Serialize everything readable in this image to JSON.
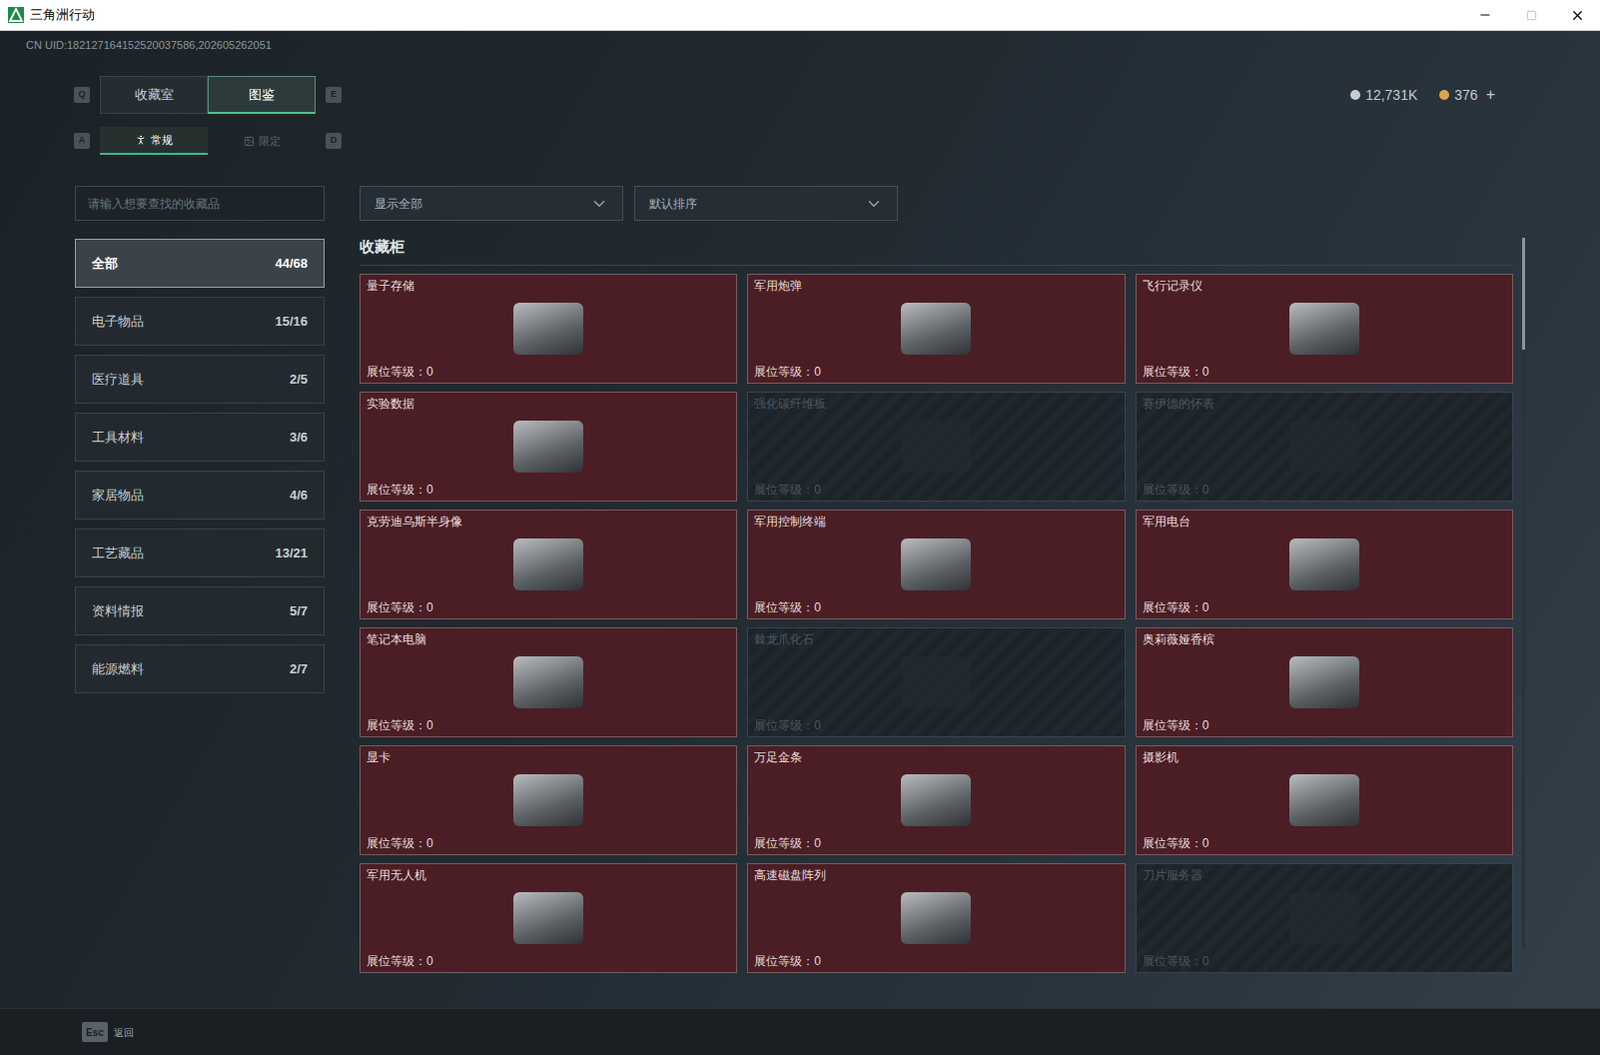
{
  "window": {
    "title": "三角洲行动"
  },
  "uid": "CN UID:182127164152520037586,202605262051",
  "main_tabs": {
    "prev_key": "Q",
    "next_key": "E",
    "items": [
      {
        "label": "收藏室",
        "selected": false
      },
      {
        "label": "图鉴",
        "selected": true
      }
    ]
  },
  "sub_tabs": {
    "prev_key": "A",
    "next_key": "D",
    "items": [
      {
        "label": "常规",
        "selected": true
      },
      {
        "label": "限定",
        "selected": false
      }
    ]
  },
  "currency": [
    {
      "value": "12,731K",
      "color": "#c9ccce"
    },
    {
      "value": "376",
      "color": "#d9a64a"
    }
  ],
  "currency_add": "+",
  "search": {
    "placeholder": "请输入想要查找的收藏品"
  },
  "filters": [
    {
      "label": "显示全部"
    },
    {
      "label": "默认排序"
    }
  ],
  "sidebar": {
    "items": [
      {
        "label": "全部",
        "count": "44/68",
        "selected": true
      },
      {
        "label": "电子物品",
        "count": "15/16",
        "selected": false
      },
      {
        "label": "医疗道具",
        "count": "2/5",
        "selected": false
      },
      {
        "label": "工具材料",
        "count": "3/6",
        "selected": false
      },
      {
        "label": "家居物品",
        "count": "4/6",
        "selected": false
      },
      {
        "label": "工艺藏品",
        "count": "13/21",
        "selected": false
      },
      {
        "label": "资料情报",
        "count": "5/7",
        "selected": false
      },
      {
        "label": "能源燃料",
        "count": "2/7",
        "selected": false
      }
    ]
  },
  "section_title": "收藏柜",
  "cards": [
    {
      "name": "量子存储",
      "level_label": "展位等级：",
      "level": "0",
      "unlocked": true
    },
    {
      "name": "军用炮弹",
      "level_label": "展位等级：",
      "level": "0",
      "unlocked": true
    },
    {
      "name": "飞行记录仪",
      "level_label": "展位等级：",
      "level": "0",
      "unlocked": true
    },
    {
      "name": "实验数据",
      "level_label": "展位等级：",
      "level": "0",
      "unlocked": true
    },
    {
      "name": "强化碳纤维板",
      "level_label": "展位等级：",
      "level": "0",
      "unlocked": false
    },
    {
      "name": "赛伊德的怀表",
      "level_label": "展位等级：",
      "level": "0",
      "unlocked": false
    },
    {
      "name": "克劳迪乌斯半身像",
      "level_label": "展位等级：",
      "level": "0",
      "unlocked": true
    },
    {
      "name": "军用控制终端",
      "level_label": "展位等级：",
      "level": "0",
      "unlocked": true
    },
    {
      "name": "军用电台",
      "level_label": "展位等级：",
      "level": "0",
      "unlocked": true
    },
    {
      "name": "笔记本电脑",
      "level_label": "展位等级：",
      "level": "0",
      "unlocked": true
    },
    {
      "name": "棘龙爪化石",
      "level_label": "展位等级：",
      "level": "0",
      "unlocked": false
    },
    {
      "name": "奥莉薇娅香槟",
      "level_label": "展位等级：",
      "level": "0",
      "unlocked": true
    },
    {
      "name": "显卡",
      "level_label": "展位等级：",
      "level": "0",
      "unlocked": true
    },
    {
      "name": "万足金条",
      "level_label": "展位等级：",
      "level": "0",
      "unlocked": true
    },
    {
      "name": "摄影机",
      "level_label": "展位等级：",
      "level": "0",
      "unlocked": true
    },
    {
      "name": "军用无人机",
      "level_label": "展位等级：",
      "level": "0",
      "unlocked": true
    },
    {
      "name": "高速磁盘阵列",
      "level_label": "展位等级：",
      "level": "0",
      "unlocked": true
    },
    {
      "name": "刀片服务器",
      "level_label": "展位等级：",
      "level": "0",
      "unlocked": false
    }
  ],
  "footer": {
    "key": "Esc",
    "label": "返回"
  }
}
